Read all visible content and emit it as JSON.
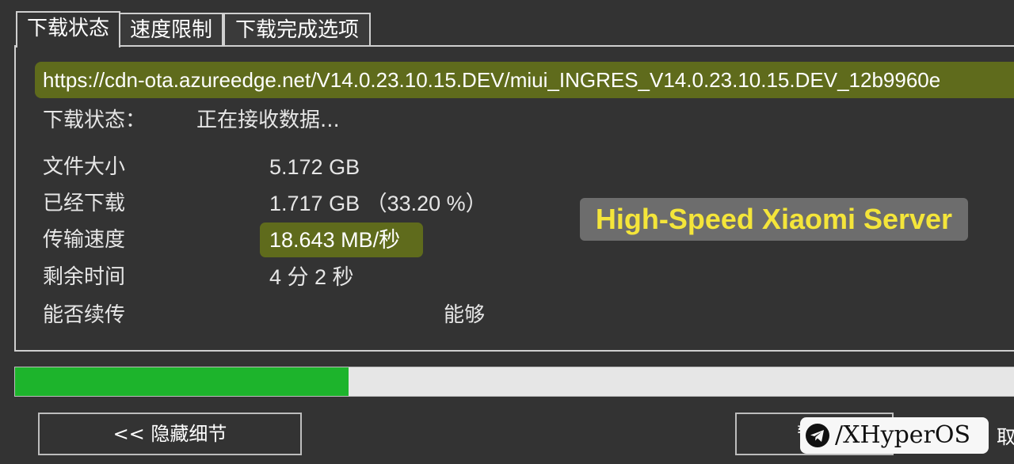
{
  "tabs": [
    {
      "label": "下载状态",
      "active": true
    },
    {
      "label": "速度限制",
      "active": false
    },
    {
      "label": "下载完成选项",
      "active": false
    }
  ],
  "url": "https://cdn-ota.azureedge.net/V14.0.23.10.15.DEV/miui_INGRES_V14.0.23.10.15.DEV_12b9960e",
  "status": {
    "label": "下载状态：",
    "value": "正在接收数据..."
  },
  "fields": {
    "file_size": {
      "label": "文件大小",
      "value": "5.172  GB"
    },
    "downloaded": {
      "label": "已经下载",
      "value": "1.717  GB （33.20 %）"
    },
    "speed": {
      "label": "传输速度",
      "value": "18.643  MB/秒"
    },
    "remaining": {
      "label": "剩余时间",
      "value": "4 分 2 秒"
    },
    "resumable": {
      "label": "能否续传",
      "value": "能够"
    }
  },
  "overlay": {
    "text": "High-Speed Xiaomi Server"
  },
  "progress": {
    "percent": 33.2
  },
  "buttons": {
    "hide_details": "<< 隐藏细节",
    "pause_partial": "暂",
    "cancel_partial": "取"
  },
  "watermark": {
    "text": "/XHyperOS",
    "icon": "telegram-icon"
  },
  "colors": {
    "background": "#333333",
    "highlight": "#5f6b1c",
    "progress": "#1db42c",
    "overlay_text": "#f4e53a"
  }
}
